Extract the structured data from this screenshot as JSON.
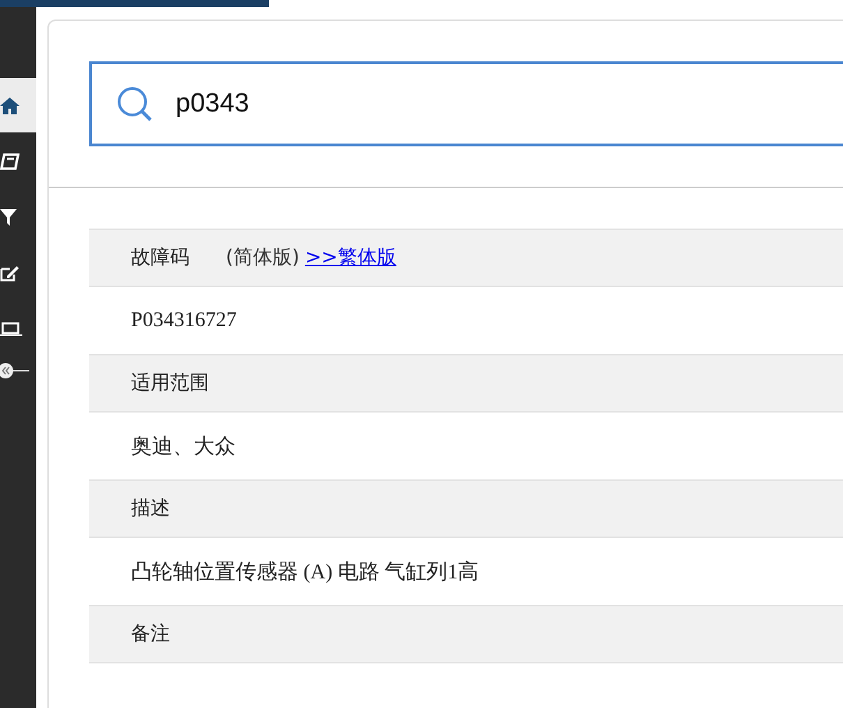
{
  "sidebar": {
    "items": [
      {
        "kind": "home",
        "selected": true
      },
      {
        "kind": "book",
        "selected": false
      },
      {
        "kind": "filter",
        "selected": false
      },
      {
        "kind": "edit",
        "selected": false
      },
      {
        "kind": "laptop",
        "selected": false
      }
    ]
  },
  "search": {
    "value": "p0343"
  },
  "sections": [
    {
      "label": "故障码",
      "note": "(简体版)",
      "link": ">>繁体版",
      "value": "P034316727"
    },
    {
      "label": "适用范围",
      "value": "奥迪、大众"
    },
    {
      "label": "描述",
      "value": "凸轮轴位置传感器 (A) 电路 气缸列1高"
    },
    {
      "label": "备注"
    }
  ]
}
